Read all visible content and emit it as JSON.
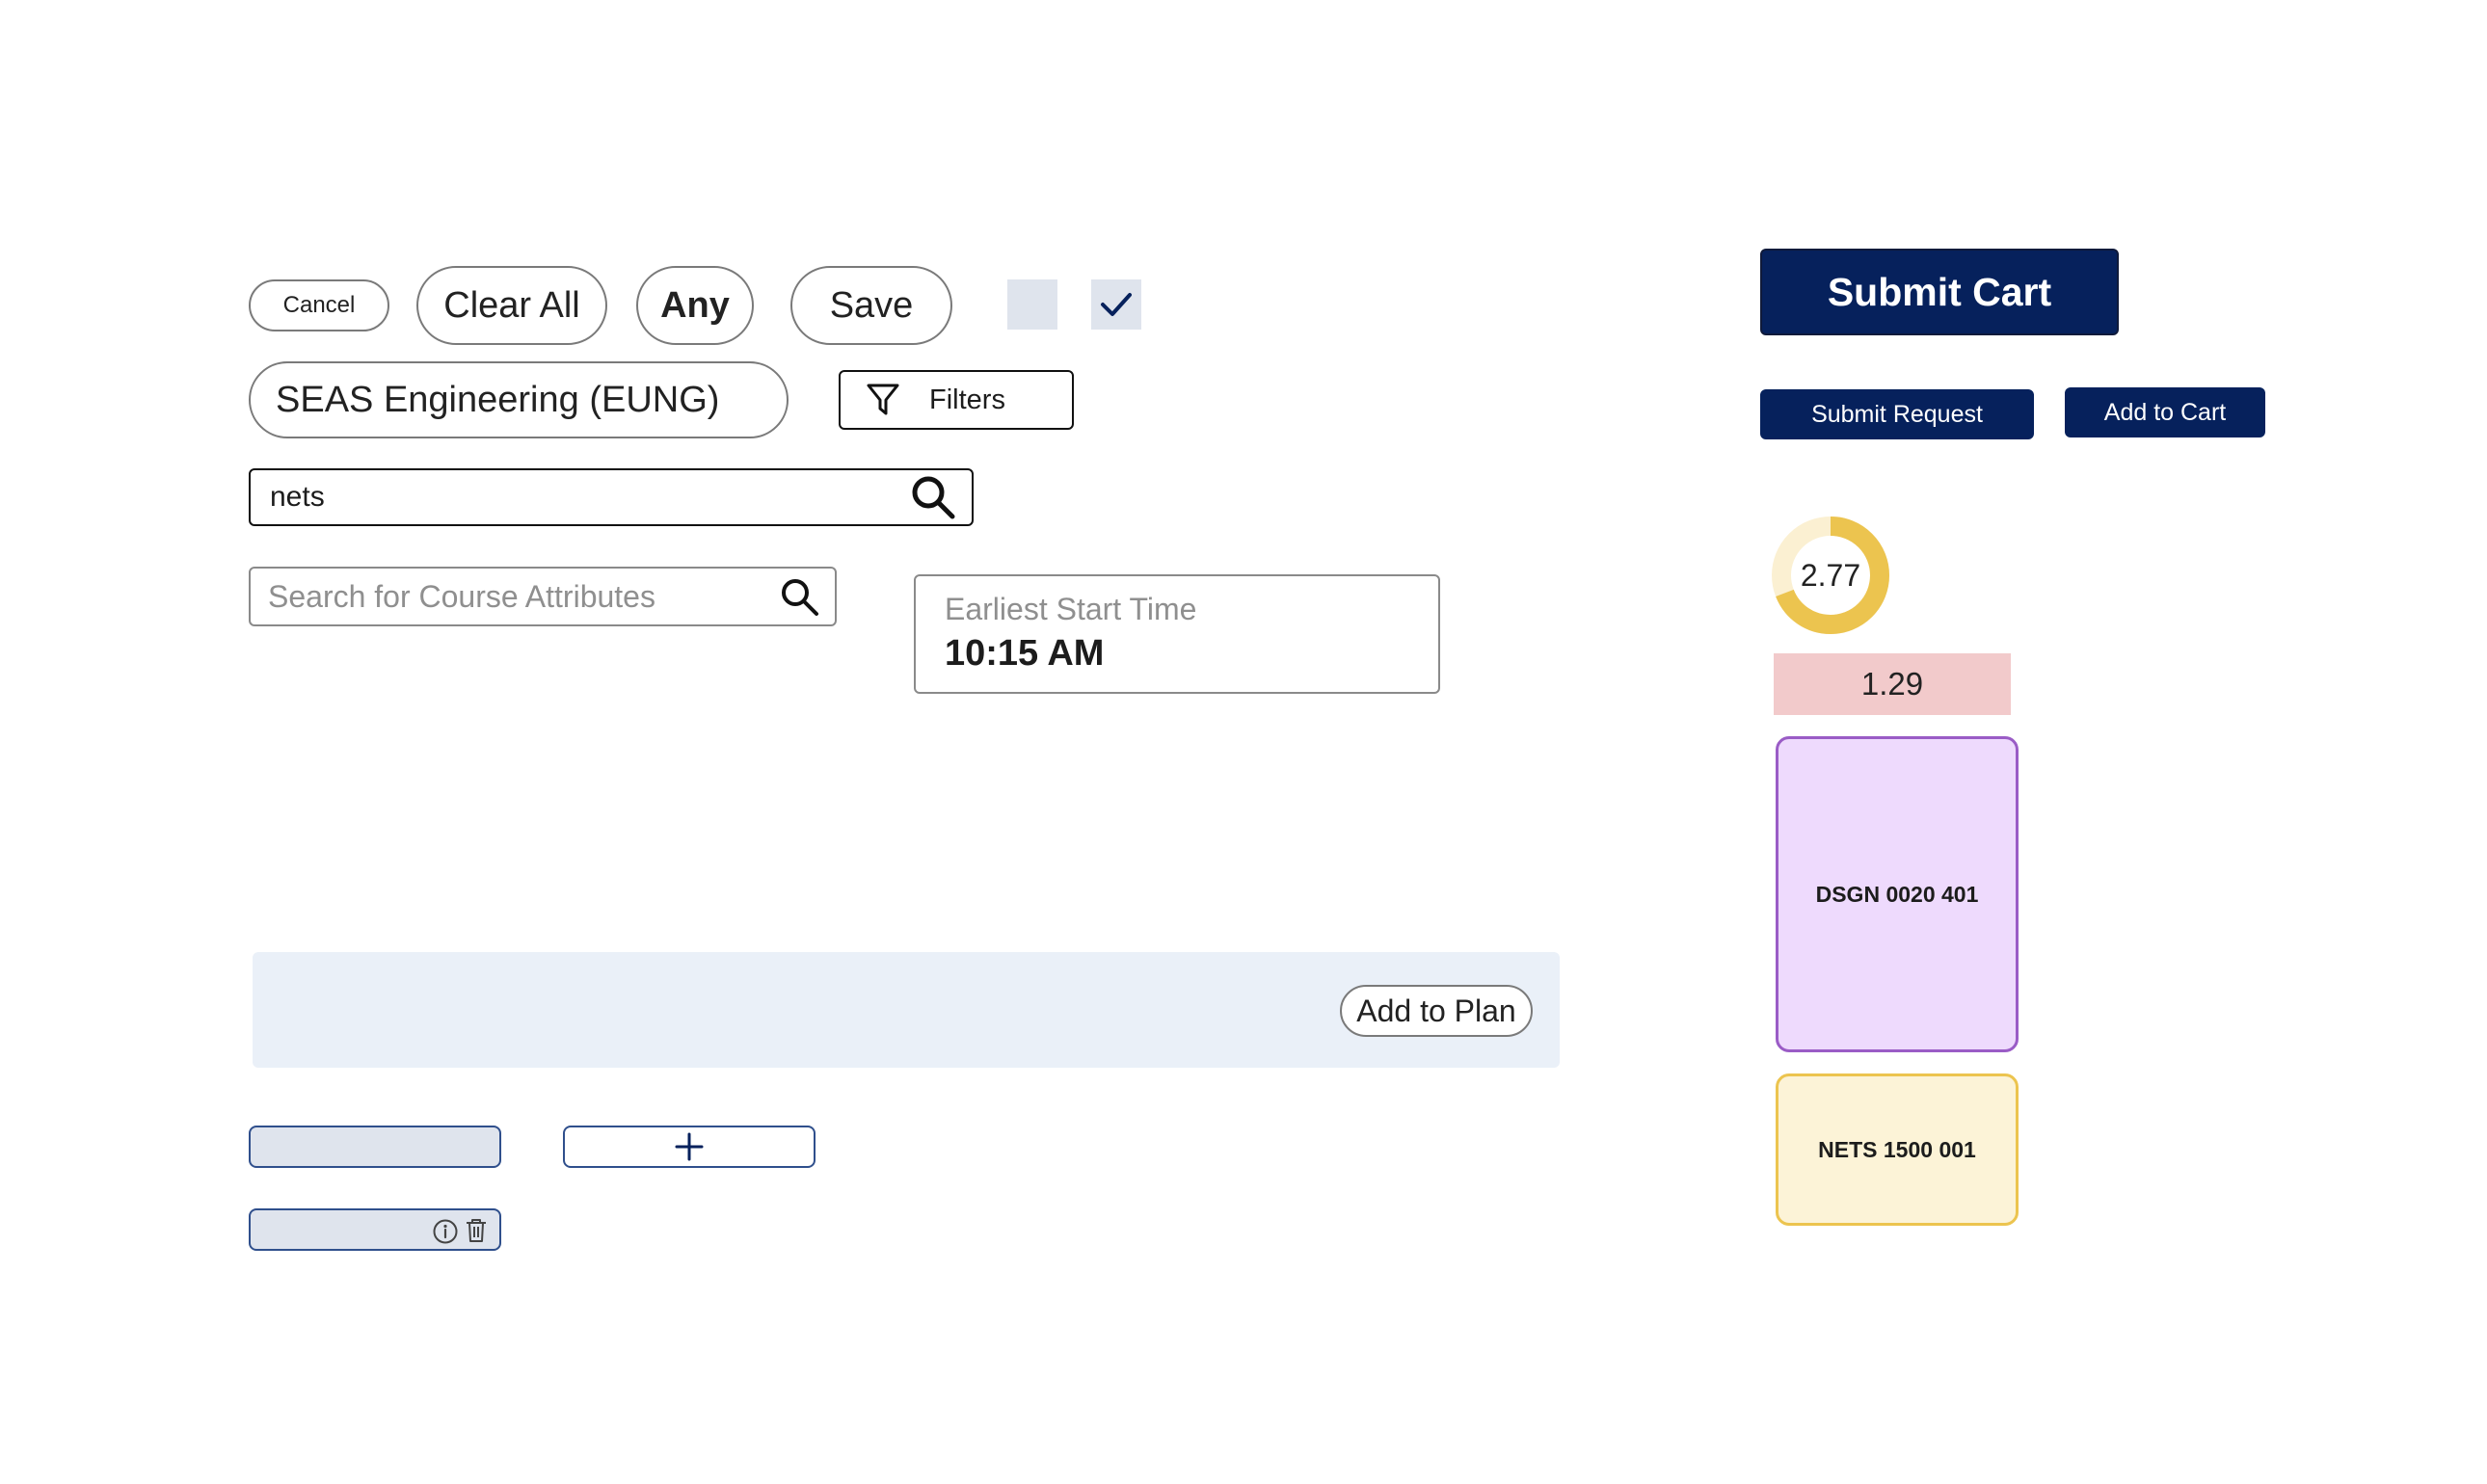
{
  "buttons": {
    "cancel": "Cancel",
    "clear_all": "Clear All",
    "any": "Any",
    "save": "Save",
    "filters": "Filters",
    "submit_cart": "Submit Cart",
    "submit_request": "Submit Request",
    "add_to_cart": "Add to Cart",
    "add_to_plan": "Add to Plan",
    "add_plus": "+"
  },
  "checkboxes": {
    "unchecked": false,
    "checked": true
  },
  "school_select": {
    "value": "SEAS Engineering (EUNG)"
  },
  "course_search": {
    "value": "nets"
  },
  "attribute_search": {
    "placeholder": "Search for Course Attributes"
  },
  "start_time": {
    "label": "Earliest Start Time",
    "value": "10:15 AM"
  },
  "rating_ring": {
    "value": "2.77",
    "fill_fraction": 0.69,
    "color": "#ecc44f",
    "track_color": "#fbf0d2"
  },
  "difficulty_badge": {
    "value": "1.29",
    "color": "#f2cacb"
  },
  "schedule_blocks": [
    {
      "label": "DSGN 0020 401",
      "bg": "#eedafd",
      "border": "#9a5cc6"
    },
    {
      "label": "NETS 1500 001",
      "bg": "#fcf3d7",
      "border": "#ecc44f"
    }
  ],
  "icons": [
    "search-icon",
    "filter-icon",
    "check-icon",
    "info-icon",
    "trash-icon",
    "plus-icon"
  ],
  "colors": {
    "navy": "#06215c",
    "light_panel": "#eaf0f8",
    "chip_fill": "#dfe4ed"
  }
}
